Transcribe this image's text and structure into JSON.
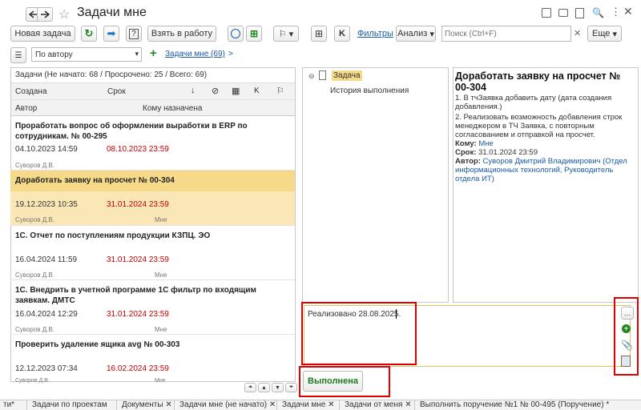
{
  "window": {
    "title": "Задачи мне"
  },
  "toolbar": {
    "new_task": "Новая задача",
    "take_to_work": "Взять в работу",
    "filters": "Фильтры",
    "analysis": "Анализ",
    "search_placeholder": "Поиск (Ctrl+F)",
    "more": "Еще"
  },
  "filter_bar": {
    "select_value": "По автору",
    "link": "Задачи мне (69)",
    "link_arrow": ">"
  },
  "list": {
    "summary": "Задачи (Не начато: 68 / Просрочено: 25 / Всего: 69)",
    "col_created": "Создана",
    "col_due": "Срок",
    "col_author": "Автор",
    "col_assignee": "Кому назначена",
    "items": [
      {
        "title": "Проработать вопрос об оформлении выработки в ERP по сотрудникам. № 00-295",
        "created": "04.10.2023 14:59",
        "due": "08.10.2023 23:59",
        "author": "Суворов Д.В.",
        "assignee": ""
      },
      {
        "title": "Доработать заявку на просчет  № 00-304",
        "created": "19.12.2023 10:35",
        "due": "31.01.2024 23:59",
        "author": "Суворов Д.В.",
        "assignee": "Мне"
      },
      {
        "title": "1С. Отчет по поступлениям продукции КЗПЦ. ЭО",
        "created": "16.04.2024 11:59",
        "due": "31.01.2024 23:59",
        "author": "Суворов Д.В.",
        "assignee": "Мне"
      },
      {
        "title": "1С. Внедрить в учетной программе 1С фильтр по входящим заявкам. ДМТС",
        "created": "16.04.2024 12:29",
        "due": "31.01.2024 23:59",
        "author": "Суворов Д.В.",
        "assignee": "Мне"
      },
      {
        "title": "Проверить удаление ящика avg № 00-303",
        "created": "12.12.2023 07:34",
        "due": "16.02.2024 23:59",
        "author": "Суворов Д.В.",
        "assignee": "Мне"
      }
    ]
  },
  "tree": {
    "task": "Задача",
    "history": "История выполнения"
  },
  "detail": {
    "title": "Доработать заявку на просчет  № 00-304",
    "body1": "1. В тчЗаявка добавить дату (дата создания добавления.)",
    "body2": "2. Реализовать возможность добавления строк менеджером в ТЧ Заявка, с повторным согласованием и отправкой на просчет.",
    "to_label": "Кому:",
    "to_value": "Мне",
    "due_label": "Срок:",
    "due_value": "31.01.2024 23:59",
    "author_label": "Автор:",
    "author_value": "Суворов Дмитрий Владимирович (Отдел информационных технологий, Руководитель отдела ИТ)"
  },
  "comment": {
    "text": "Реализовано 28.08.2025."
  },
  "done_button": "Выполнена",
  "bottom_tabs": [
    "ти*",
    "Задачи по проектам",
    "Документы",
    "Задачи мне (не начато)",
    "Задачи мне",
    "Задачи от меня",
    "Выполнить поручение №1 № 00-495 (Поручение) *"
  ],
  "colors": {
    "accent_red": "#e00000",
    "selected_row": "#fbe7b5",
    "link": "#1a5aa6",
    "due_red": "#c00000",
    "green": "#1e8a1e"
  }
}
